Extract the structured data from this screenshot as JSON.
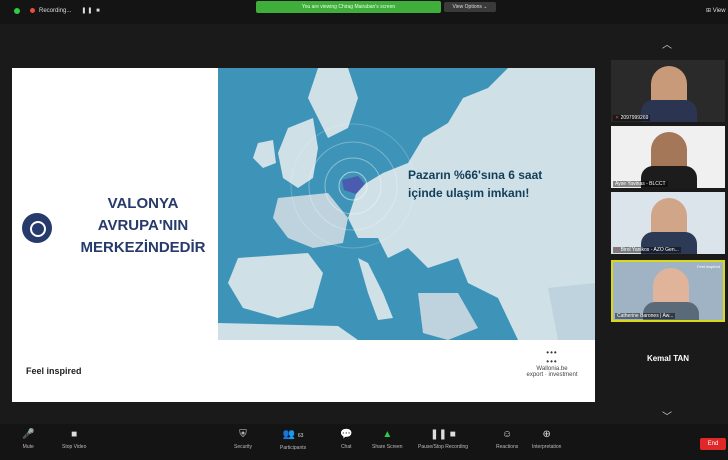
{
  "topbar": {
    "recording_label": "Recording...",
    "recording_controls": "❚❚ ■",
    "share_notice": "You are viewing Chirag Mairaban's screen",
    "view_options": "View Options ⌄",
    "view_button": "⊞ View"
  },
  "slide": {
    "title_lines": [
      "VALONYA",
      "AVRUPA'NIN",
      "MERKEZİNDEDİR"
    ],
    "map_text_lines": [
      "Pazarın %66'sına 6 saat",
      "içinde ulaşım imkanı!"
    ],
    "footer": "Feel inspired",
    "brand_name": "Wallonia.be",
    "brand_sub": "export · investment",
    "colors": {
      "accent": "#263a6b",
      "sea": "#3d94b8",
      "land": "#cfe0e7",
      "belgium": "#4a5bb0"
    }
  },
  "participants": [
    {
      "name": "2097999269",
      "muted": true
    },
    {
      "name": "Ayse Yavinas - BLCCT",
      "muted": false
    },
    {
      "name": "Birol Yanikos - AZO Gen...",
      "muted": true
    },
    {
      "name": "Catherine Barones | Aw...",
      "muted": false,
      "badge": "Feel inspired",
      "active": true
    }
  ],
  "speaker_name": "Kemal TAN",
  "toolbar": {
    "mute": "Mute",
    "stop_video": "Stop Video",
    "security": "Security",
    "participants": "Participants",
    "participants_count": "63",
    "chat": "Chat",
    "share_screen": "Share Screen",
    "record": "Pause/Stop Recording",
    "reactions": "Reactions",
    "interpretation": "Interpretation",
    "end": "End"
  }
}
